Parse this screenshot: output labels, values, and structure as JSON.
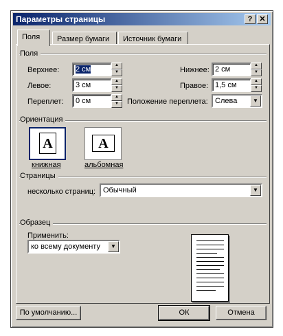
{
  "window": {
    "title": "Параметры страницы",
    "help_label": "?",
    "close_label": "✕"
  },
  "tabs": [
    {
      "label": "Поля",
      "active": true
    },
    {
      "label": "Размер бумаги",
      "active": false
    },
    {
      "label": "Источник бумаги",
      "active": false
    }
  ],
  "margins": {
    "group_label": "Поля",
    "top": {
      "label": "Верхнее:",
      "value": "2 см"
    },
    "bottom": {
      "label": "Нижнее:",
      "value": "2 см"
    },
    "left": {
      "label": "Левое:",
      "value": "3 см"
    },
    "right": {
      "label": "Правое:",
      "value": "1,5 см"
    },
    "gutter": {
      "label": "Переплет:",
      "value": "0 см"
    },
    "gutter_position": {
      "label": "Положение переплета:",
      "value": "Слева"
    }
  },
  "orientation": {
    "group_label": "Ориентация",
    "portrait": {
      "label": "книжная",
      "glyph": "A",
      "selected": true
    },
    "landscape": {
      "label": "альбомная",
      "glyph": "A",
      "selected": false
    }
  },
  "pages": {
    "group_label": "Страницы",
    "multiple_label": "несколько страниц:",
    "multiple_value": "Обычный"
  },
  "preview": {
    "group_label": "Образец",
    "apply_label": "Применить:",
    "apply_value": "ко всему документу"
  },
  "buttons": {
    "default_label": "По умолчанию...",
    "ok_label": "ОК",
    "cancel_label": "Отмена"
  },
  "icons": {
    "spin_up": "▲",
    "spin_down": "▼",
    "dropdown": "▼"
  },
  "colors": {
    "dialog_bg": "#d4d0c8",
    "title_bar": "#0a246a",
    "selection": "#0a246a"
  }
}
